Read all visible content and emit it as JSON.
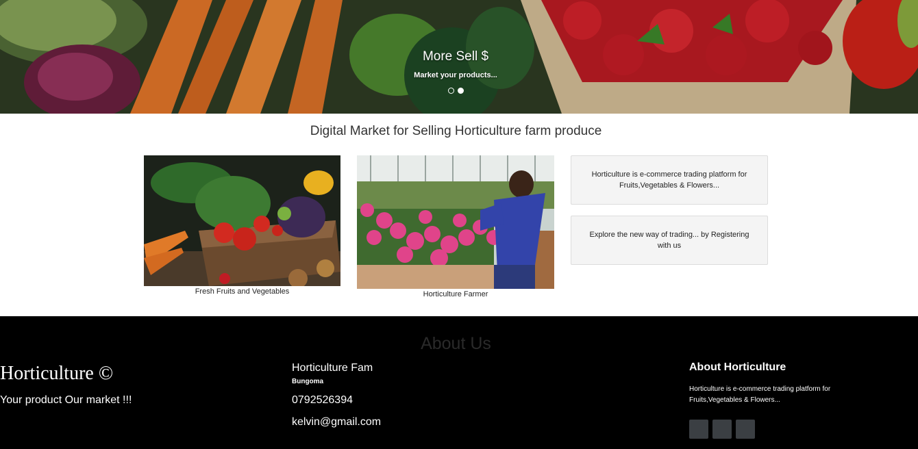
{
  "hero": {
    "slide_title": "More Sell $",
    "slide_subtitle": "Market your products...",
    "active_slide": 2,
    "slide_count": 2
  },
  "intro": {
    "title": "Digital Market for Selling Horticulture farm produce",
    "cards": [
      {
        "caption": "Fresh Fruits and Vegetables"
      },
      {
        "caption": "Horticulture Farmer"
      }
    ],
    "info_boxes": [
      "Horticulture is e-commerce trading platform for Fruits,Vegetables & Flowers...",
      "Explore the new way of trading... by Registering with us"
    ]
  },
  "footer": {
    "heading": "About Us",
    "brand": "Horticulture ©",
    "slogan": "Your product Our market !!!",
    "contact": {
      "name": "Horticulture Fam",
      "town": "Bungoma",
      "phone": "0792526394",
      "email": "kelvin@gmail.com"
    },
    "about": {
      "title": "About Horticulture",
      "text": "Horticulture is e-commerce trading platform for Fruits,Vegetables & Flowers..."
    },
    "social_icons": [
      "social-icon-1",
      "social-icon-2",
      "social-icon-3"
    ]
  },
  "colors": {
    "footer_bg": "#000000",
    "info_box_bg": "#f4f4f4",
    "social_button": "#3b3f43"
  }
}
